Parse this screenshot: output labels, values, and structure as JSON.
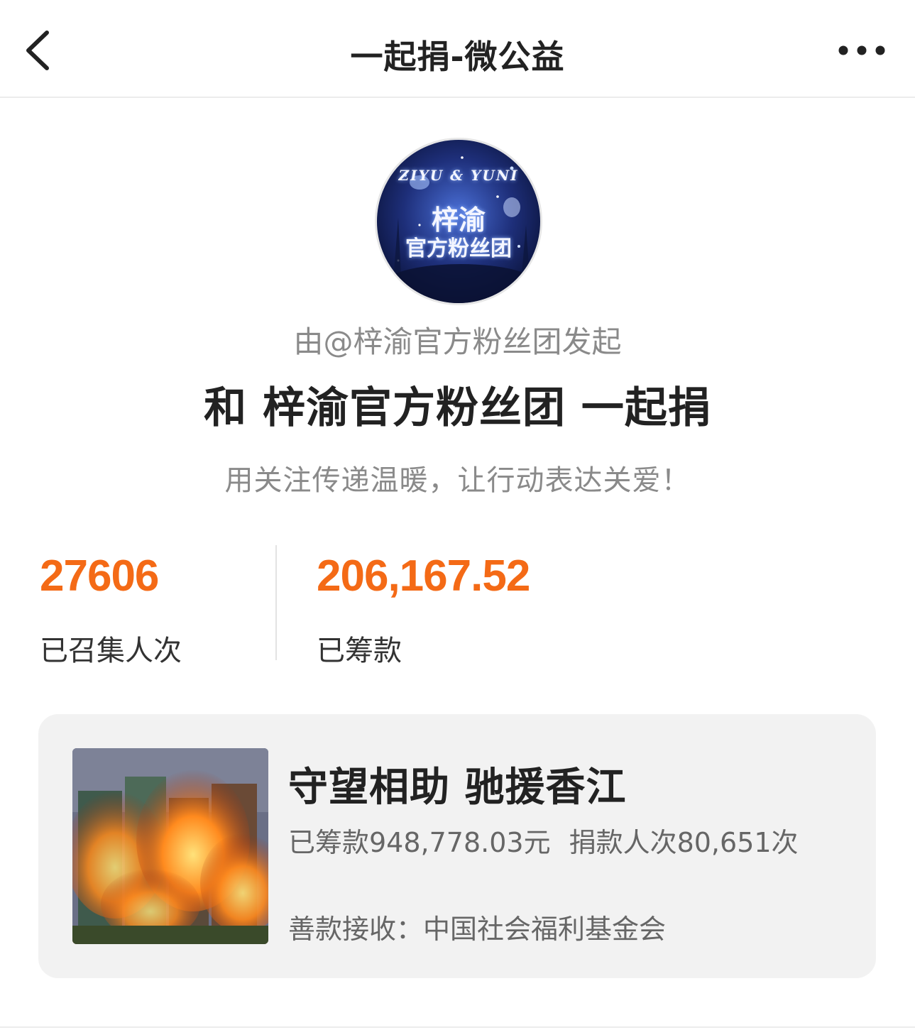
{
  "navbar": {
    "title": "一起捐-微公益",
    "back_icon": "chevron-left-icon",
    "more_icon": "more-dots-icon"
  },
  "avatar": {
    "line1": "ZIYU & YUNI",
    "line2": "梓渝",
    "line3": "官方粉丝团"
  },
  "header": {
    "initiator": "由@梓渝官方粉丝团发起",
    "headline": "和 梓渝官方粉丝团 一起捐",
    "slogan": "用关注传递温暖，让行动表达关爱！"
  },
  "stats": {
    "participants_value": "27606",
    "participants_label": "已召集人次",
    "raised_value": "206,167.52",
    "raised_label": "已筹款"
  },
  "project": {
    "title": "守望相助 驰援香江",
    "raised": "已筹款948,778.03元",
    "donors": "捐款人次80,651次",
    "recipient": "善款接收：中国社会福利基金会"
  },
  "colors": {
    "accent": "#f46a16",
    "card_bg": "#f2f2f2",
    "muted_text": "#8a8a8a"
  }
}
